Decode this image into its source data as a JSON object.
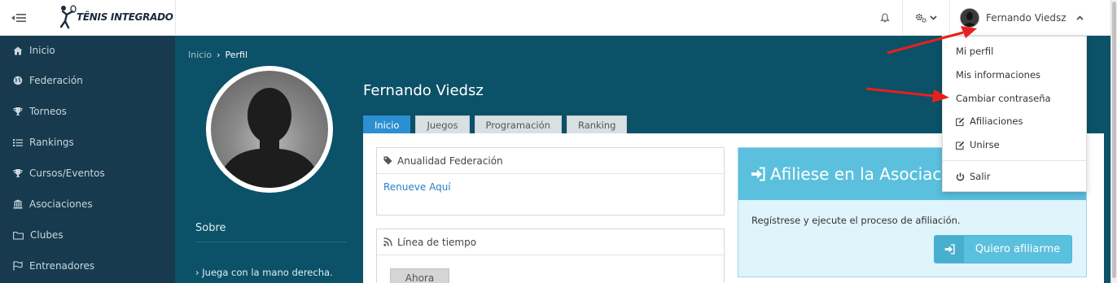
{
  "topbar": {
    "logo_text": "TÊNIS INTEGRADO",
    "user_name": "Fernando Viedsz"
  },
  "sidebar": {
    "items": [
      {
        "label": "Inicio",
        "icon": "home-icon"
      },
      {
        "label": "Federación",
        "icon": "globe-icon"
      },
      {
        "label": "Torneos",
        "icon": "trophy-icon"
      },
      {
        "label": "Rankings",
        "icon": "list-icon"
      },
      {
        "label": "Cursos/Eventos",
        "icon": "trophy-icon"
      },
      {
        "label": "Asociaciones",
        "icon": "institution-icon"
      },
      {
        "label": "Clubes",
        "icon": "folder-icon"
      },
      {
        "label": "Entrenadores",
        "icon": "flag-icon"
      }
    ]
  },
  "breadcrumb": {
    "home": "Inicio",
    "current": "Perfil"
  },
  "profile": {
    "name": "Fernando Viedsz",
    "sobre_title": "Sobre",
    "sobre_item": "Juega con la mano derecha."
  },
  "tabs": [
    {
      "label": "Inicio",
      "active": true
    },
    {
      "label": "Juegos",
      "active": false
    },
    {
      "label": "Programación",
      "active": false
    },
    {
      "label": "Ranking",
      "active": false
    }
  ],
  "anualidad": {
    "title": "Anualidad Federación",
    "link": "Renueve Aquí"
  },
  "linea": {
    "title": "Línea de tiempo",
    "button": "Ahora"
  },
  "afiliacion": {
    "title": "Afiliese en la Asociaci",
    "text": "Regístrese y ejecute el proceso de afiliación.",
    "button": "Quiero afiliarme"
  },
  "dropdown": {
    "items": [
      "Mi perfil",
      "Mis informaciones",
      "Cambiar contraseña",
      "Afiliaciones",
      "Unirse",
      "Salir"
    ]
  },
  "colors": {
    "sidebar": "#173a4e",
    "content": "#0b5168",
    "accent_tab": "#2b8fd1",
    "info": "#5bc0de",
    "arrow": "#e8201c"
  }
}
